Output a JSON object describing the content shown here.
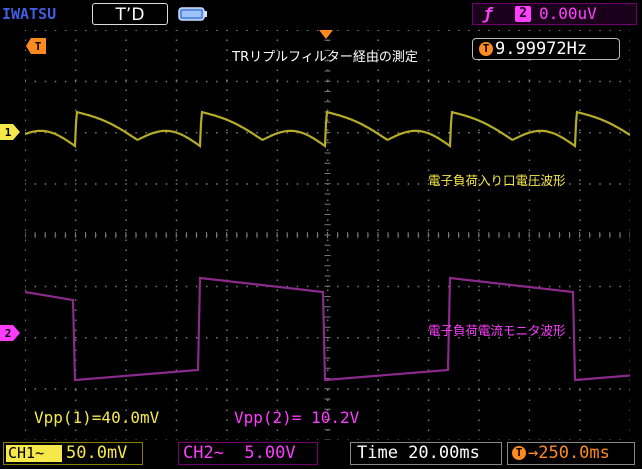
{
  "header": {
    "brand": "IWATSU",
    "mode": "T’D",
    "trigger_slope_icon": "rising-edge-icon",
    "trigger_source": "2",
    "trigger_level": "0.00uV"
  },
  "screen": {
    "title": "TRリプルフィルター経由の測定",
    "frequency": "9.99972Hz",
    "frequency_icon_label": "T",
    "trigger_marker_label": "T",
    "ch1_marker": "1",
    "ch2_marker": "2",
    "ch1_annotation": "電子負荷入り口電圧波形",
    "ch2_annotation": "電子負荷電流モニタ波形",
    "measurements": {
      "vpp1": "Vpp(1)=40.0mV",
      "vpp2": "Vpp(2)= 10.2V"
    }
  },
  "footer": {
    "ch1_tag": "CH1~",
    "ch1_scale": "50.0mV",
    "ch2_label": "CH2~  5.00V",
    "time_label": "Time 20.00ms",
    "trigger_icon_label": "T",
    "trigger_delay": "→250.0ms"
  },
  "colors": {
    "ch1": "#b5ac28",
    "ch1_text": "#f7e84a",
    "ch2": "#8a2a8a",
    "ch2_text": "#ff3cff",
    "trigger": "#ff8a1f",
    "grid": "#7a7a7a"
  }
}
